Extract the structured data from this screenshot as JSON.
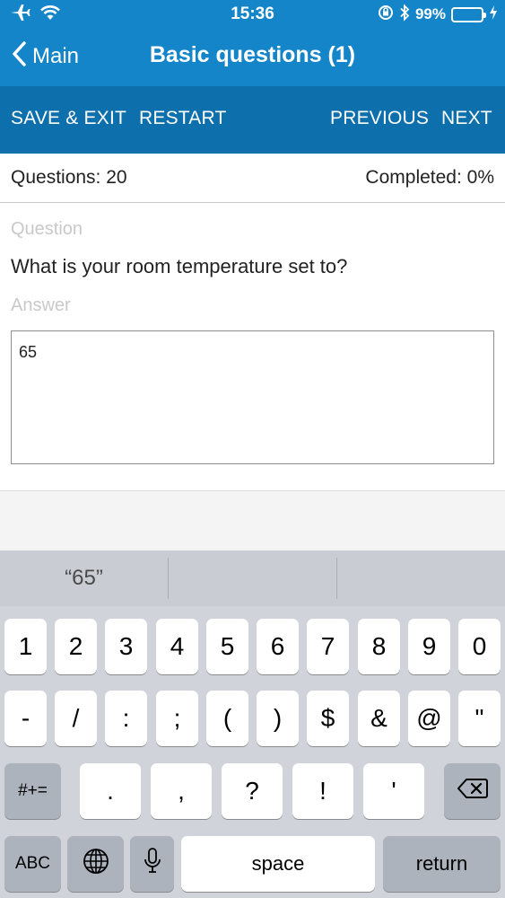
{
  "status_bar": {
    "time": "15:36",
    "battery": "99%",
    "battery_level": 0.99,
    "icons": [
      "airplane-icon",
      "wifi-icon",
      "orientation-lock-icon",
      "bluetooth-icon",
      "battery-icon",
      "charging-icon"
    ]
  },
  "nav": {
    "back_label": "Main",
    "title": "Basic questions (1)"
  },
  "toolbar": {
    "save_exit": "SAVE & EXIT",
    "restart": "RESTART",
    "previous": "PREVIOUS",
    "next": "NEXT"
  },
  "info": {
    "questions": "Questions: 20",
    "completed": "Completed: 0%"
  },
  "form": {
    "question_label": "Question",
    "question_text": "What is your room temperature set to?",
    "answer_label": "Answer",
    "answer_value": "65"
  },
  "keyboard": {
    "prediction": "“65”",
    "row1": [
      "1",
      "2",
      "3",
      "4",
      "5",
      "6",
      "7",
      "8",
      "9",
      "0"
    ],
    "row2": [
      "-",
      "/",
      ":",
      ";",
      "(",
      ")",
      "$",
      "&",
      "@",
      "\""
    ],
    "row3_left": "#+=",
    "row3": [
      ".",
      ",",
      "?",
      "!",
      "'"
    ],
    "abc": "ABC",
    "space": "space",
    "return": "return"
  },
  "colors": {
    "nav_blue": "#1585c9",
    "toolbar_blue": "#0e6fad",
    "battery_green": "#4cd964"
  }
}
